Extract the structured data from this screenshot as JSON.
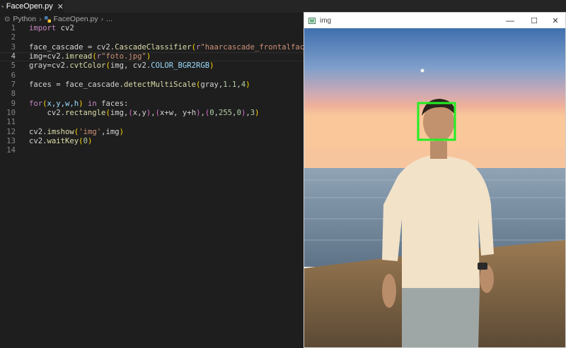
{
  "tab": {
    "filename": "FaceOpen.py"
  },
  "breadcrumb": {
    "part1": "Python",
    "part2": "FaceOpen.py",
    "part3": "..."
  },
  "code_lines": [
    {
      "n": "1"
    },
    {
      "n": "2"
    },
    {
      "n": "3"
    },
    {
      "n": "4"
    },
    {
      "n": "5"
    },
    {
      "n": "6"
    },
    {
      "n": "7"
    },
    {
      "n": "8"
    },
    {
      "n": "9"
    },
    {
      "n": "10"
    },
    {
      "n": "11"
    },
    {
      "n": "12"
    },
    {
      "n": "13"
    },
    {
      "n": "14"
    }
  ],
  "code": {
    "l1_kw": "import",
    "l1_mod": " cv2",
    "l3_a": "face_cascade = cv2.",
    "l3_b": "CascadeClassifier",
    "l3_p": "(",
    "l3_r": "r",
    "l3_s": "\"haarcascade_frontalface_default",
    "l4_a": "img=cv2.",
    "l4_b": "imread",
    "l4_p": "(",
    "l4_r": "r",
    "l4_s": "\"foto.jpg\"",
    "l4_e": ")",
    "l5_a": "gray=cv2.",
    "l5_b": "cvtColor",
    "l5_p": "(",
    "l5_c": "img, cv2.",
    "l5_d": "COLOR_BGR2RGB",
    "l5_e": ")",
    "l7_a": "faces = face_cascade.",
    "l7_b": "detectMultiScale",
    "l7_p": "(",
    "l7_c": "gray,",
    "l7_n1": "1.1",
    "l7_c2": ",",
    "l7_n2": "4",
    "l7_e": ")",
    "l9_kw": "for",
    "l9_p": "(",
    "l9_v": "x,y,w,h",
    "l9_e": ")",
    "l9_in": " in",
    "l9_rest": " faces:",
    "l10_a": "    cv2.",
    "l10_b": "rectangle",
    "l10_p": "(",
    "l10_c": "img,",
    "l10_t1": "(",
    "l10_c2": "x,y",
    "l10_t2": ")",
    "l10_c3": ",",
    "l10_t3": "(",
    "l10_c4": "x+w, y+h",
    "l10_t4": ")",
    "l10_c5": ",",
    "l10_t5": "(",
    "l10_n1": "0",
    "l10_c6": ",",
    "l10_n2": "255",
    "l10_c7": ",",
    "l10_n3": "0",
    "l10_t6": ")",
    "l10_c8": ",",
    "l10_n4": "3",
    "l10_e": ")",
    "l12_a": "cv2.",
    "l12_b": "imshow",
    "l12_p": "(",
    "l12_s": "'img'",
    "l12_c": ",img",
    "l12_e": ")",
    "l13_a": "cv2.",
    "l13_b": "waitKey",
    "l13_p": "(",
    "l13_n": "0",
    "l13_e": ")"
  },
  "window": {
    "title": "img",
    "min": "—",
    "max": "☐",
    "close": "✕"
  },
  "colors": {
    "detection_box": "#22ee22",
    "editor_bg": "#1e1e1e"
  }
}
